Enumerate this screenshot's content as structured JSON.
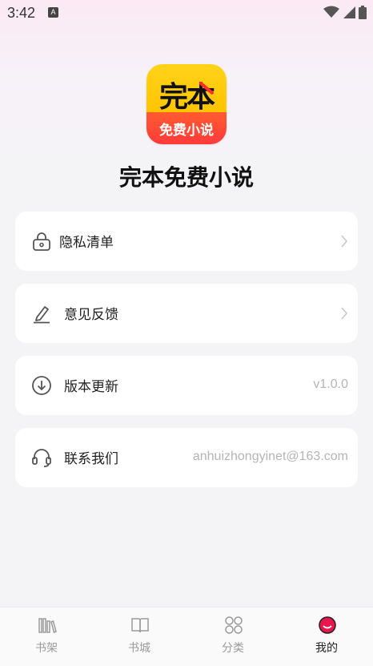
{
  "status_bar": {
    "time": "3:42",
    "notification_glyph": "A"
  },
  "app": {
    "logo_text_top": "完本",
    "logo_text_bottom": "免费小说",
    "name": "完本免费小说"
  },
  "menu": [
    {
      "icon": "lock-icon",
      "label": "隐私清单",
      "value": "",
      "has_chevron": true
    },
    {
      "icon": "edit-pen-icon",
      "label": "意见反馈",
      "value": "",
      "has_chevron": true
    },
    {
      "icon": "download-circle-icon",
      "label": "版本更新",
      "value": "v1.0.0",
      "has_chevron": false
    },
    {
      "icon": "headset-icon",
      "label": "联系我们",
      "value": "anhuizhongyinet@163.com",
      "has_chevron": false
    }
  ],
  "tabs": [
    {
      "icon": "bookshelf-icon",
      "label": "书架",
      "active": false
    },
    {
      "icon": "open-book-icon",
      "label": "书城",
      "active": false
    },
    {
      "icon": "category-grid-icon",
      "label": "分类",
      "active": false
    },
    {
      "icon": "profile-face-icon",
      "label": "我的",
      "active": true
    }
  ],
  "colors": {
    "accent": "#e8174d",
    "inactive_tab": "#9a9a9a",
    "value_text": "#b5b5b5"
  }
}
